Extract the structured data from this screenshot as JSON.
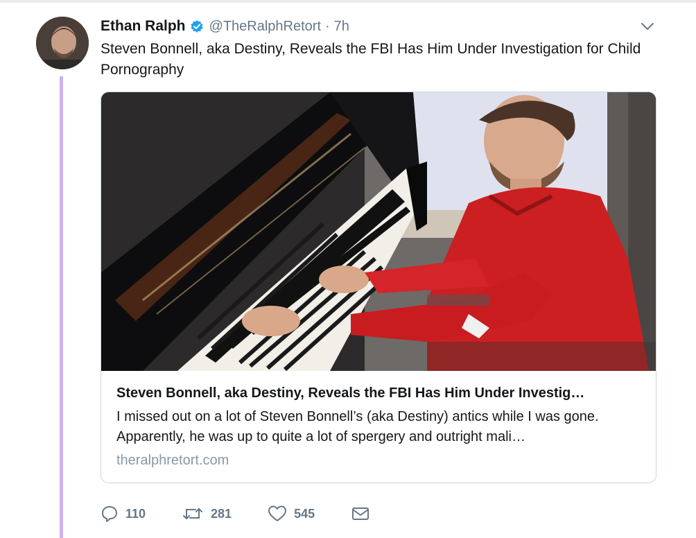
{
  "tweet": {
    "author_name": "Ethan Ralph",
    "handle": "@TheRalphRetort",
    "separator": "·",
    "time": "7h",
    "text": "Steven Bonnell, aka Destiny, Reveals the FBI Has Him Under Investigation for Child Pornography",
    "verified": true,
    "avatar_icon": "profile-photo",
    "thread_line_color": "#cbb3f3"
  },
  "card": {
    "title": "Steven Bonnell, aka Destiny, Reveals the FBI Has Him Under Investig…",
    "description": "I missed out on a lot of Steven Bonnell’s (aka Destiny) antics while I was gone. Apparently, he was up to quite a lot of spergery and outright mali…",
    "domain": "theralphretort.com",
    "image_subject": "man in red shirt playing grand piano"
  },
  "actions": {
    "reply": {
      "icon": "reply-icon",
      "count": "110"
    },
    "retweet": {
      "icon": "retweet-icon",
      "count": "281"
    },
    "like": {
      "icon": "heart-icon",
      "count": "545"
    },
    "message": {
      "icon": "mail-icon"
    }
  },
  "colors": {
    "text": "#14171a",
    "muted": "#657786",
    "domain": "#8899a6",
    "verified_blue": "#1da1f2",
    "border": "#ccd6dd"
  }
}
